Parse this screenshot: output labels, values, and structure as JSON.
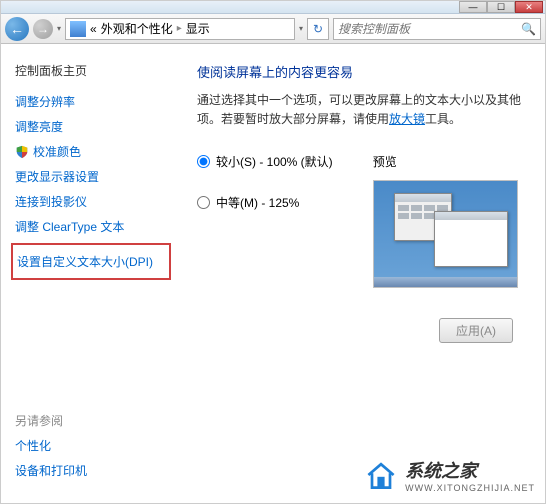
{
  "window": {
    "min": "—",
    "max": "☐",
    "close": "✕"
  },
  "nav": {
    "back": "←",
    "fwd": "→",
    "bc_prefix": "«",
    "bc_parent": "外观和个性化",
    "bc_sep": "▸",
    "bc_current": "显示",
    "refresh": "↻",
    "search_placeholder": "搜索控制面板",
    "search_icon": "🔍"
  },
  "sidebar": {
    "home": "控制面板主页",
    "links": {
      "adjust_resolution": "调整分辨率",
      "adjust_brightness": "调整亮度",
      "calibrate_color": "校准颜色",
      "change_display": "更改显示器设置",
      "connect_projector": "连接到投影仪",
      "adjust_cleartype": "调整 ClearType 文本",
      "set_custom_dpi": "设置自定义文本大小(DPI)"
    },
    "see_also": "另请参阅",
    "personalization": "个性化",
    "devices_printers": "设备和打印机"
  },
  "content": {
    "title": "使阅读屏幕上的内容更容易",
    "desc_pre": "通过选择其中一个选项，可以更改屏幕上的文本大小以及其他项。若要暂时放大部分屏幕，请使用",
    "desc_link": "放大镜",
    "desc_post": "工具。",
    "radio_small": "较小(S) - 100% (默认)",
    "radio_medium": "中等(M) - 125%",
    "preview_label": "预览",
    "apply": "应用(A)"
  },
  "watermark": {
    "brand": "系统之家",
    "url": "WWW.XITONGZHIJIA.NET"
  }
}
